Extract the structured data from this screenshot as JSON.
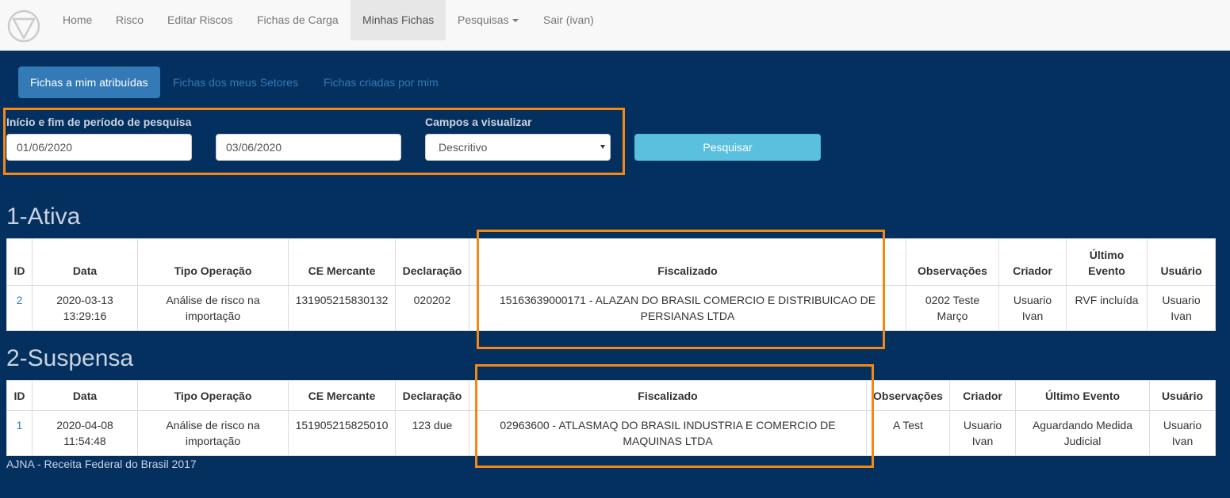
{
  "nav": {
    "items": [
      {
        "label": "Home"
      },
      {
        "label": "Risco"
      },
      {
        "label": "Editar Riscos"
      },
      {
        "label": "Fichas de Carga"
      },
      {
        "label": "Minhas Fichas"
      },
      {
        "label": "Pesquisas"
      },
      {
        "label": "Sair (ivan)"
      }
    ],
    "active": "Minhas Fichas",
    "logo_icon": "triangle-circle-logo-icon"
  },
  "tabs": [
    {
      "label": "Fichas a mim atribuídas",
      "active": true
    },
    {
      "label": "Fichas dos meus Setores",
      "active": false
    },
    {
      "label": "Fichas criadas por mim",
      "active": false
    }
  ],
  "form": {
    "period_label": "Início e fim de período de pesquisa",
    "start_date": "01/06/2020",
    "end_date": "03/06/2020",
    "fields_label": "Campos a visualizar",
    "fields_selected": "Descritivo",
    "search_button": "Pesquisar"
  },
  "sections": [
    {
      "title": "1-Ativa",
      "columns": [
        "ID",
        "Data",
        "Tipo Operação",
        "CE Mercante",
        "Declaração",
        "Fiscalizado",
        "Observações",
        "Criador",
        "Último Evento",
        "Usuário"
      ],
      "rows": [
        {
          "id": "2",
          "data": "2020-03-13 13:29:16",
          "tipo": "Análise de risco na importação",
          "ce": "131905215830132",
          "declaracao": "020202",
          "fiscalizado": "15163639000171 - ALAZAN DO BRASIL COMERCIO E DISTRIBUICAO DE PERSIANAS LTDA",
          "observacoes": "0202 Teste Março",
          "criador": "Usuario Ivan",
          "ultimo_evento": "RVF incluída",
          "usuario": "Usuario Ivan"
        }
      ]
    },
    {
      "title": "2-Suspensa",
      "columns": [
        "ID",
        "Data",
        "Tipo Operação",
        "CE Mercante",
        "Declaração",
        "Fiscalizado",
        "Observações",
        "Criador",
        "Último Evento",
        "Usuário"
      ],
      "rows": [
        {
          "id": "1",
          "data": "2020-04-08 11:54:48",
          "tipo": "Análise de risco na importação",
          "ce": "151905215825010",
          "declaracao": "123 due",
          "fiscalizado": "02963600 - ATLASMAQ DO BRASIL INDUSTRIA E COMERCIO DE MAQUINAS LTDA",
          "observacoes": "A Test",
          "criador": "Usuario Ivan",
          "ultimo_evento": "Aguardando Medida Judicial",
          "usuario": "Usuario Ivan"
        }
      ]
    }
  ],
  "footer": "AJNA - Receita Federal do Brasil 2017",
  "colors": {
    "background": "#04305f",
    "highlight": "#f68712",
    "primary": "#337ab7",
    "info": "#5bc0de"
  }
}
